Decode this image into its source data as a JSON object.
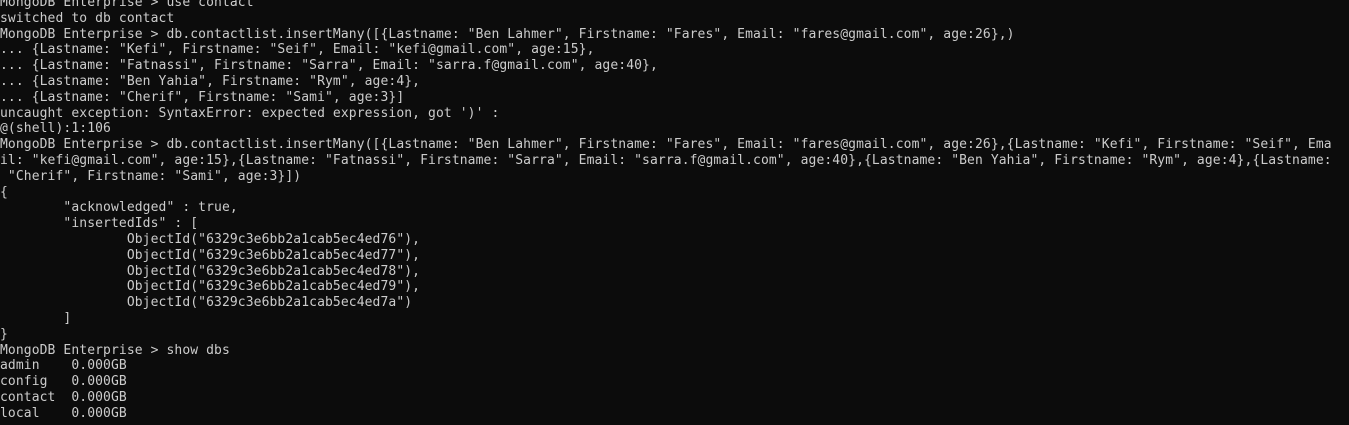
{
  "terminal": {
    "lines": [
      "MongoDB Enterprise > use contact",
      "switched to db contact",
      "MongoDB Enterprise > db.contactlist.insertMany([{Lastname: \"Ben Lahmer\", Firstname: \"Fares\", Email: \"fares@gmail.com\", age:26},)",
      "... {Lastname: \"Kefi\", Firstname: \"Seif\", Email: \"kefi@gmail.com\", age:15},",
      "... {Lastname: \"Fatnassi\", Firstname: \"Sarra\", Email: \"sarra.f@gmail.com\", age:40},",
      "... {Lastname: \"Ben Yahia\", Firstname: \"Rym\", age:4},",
      "... {Lastname: \"Cherif\", Firstname: \"Sami\", age:3}]",
      "uncaught exception: SyntaxError: expected expression, got ')' :",
      "@(shell):1:106",
      "MongoDB Enterprise > db.contactlist.insertMany([{Lastname: \"Ben Lahmer\", Firstname: \"Fares\", Email: \"fares@gmail.com\", age:26},{Lastname: \"Kefi\", Firstname: \"Seif\", Ema",
      "il: \"kefi@gmail.com\", age:15},{Lastname: \"Fatnassi\", Firstname: \"Sarra\", Email: \"sarra.f@gmail.com\", age:40},{Lastname: \"Ben Yahia\", Firstname: \"Rym\", age:4},{Lastname:",
      " \"Cherif\", Firstname: \"Sami\", age:3}])",
      "{",
      "        \"acknowledged\" : true,",
      "        \"insertedIds\" : [",
      "                ObjectId(\"6329c3e6bb2a1cab5ec4ed76\"),",
      "                ObjectId(\"6329c3e6bb2a1cab5ec4ed77\"),",
      "                ObjectId(\"6329c3e6bb2a1cab5ec4ed78\"),",
      "                ObjectId(\"6329c3e6bb2a1cab5ec4ed79\"),",
      "                ObjectId(\"6329c3e6bb2a1cab5ec4ed7a\")",
      "        ]",
      "}",
      "MongoDB Enterprise > show dbs",
      "admin    0.000GB",
      "config   0.000GB",
      "contact  0.000GB",
      "local    0.000GB"
    ]
  }
}
